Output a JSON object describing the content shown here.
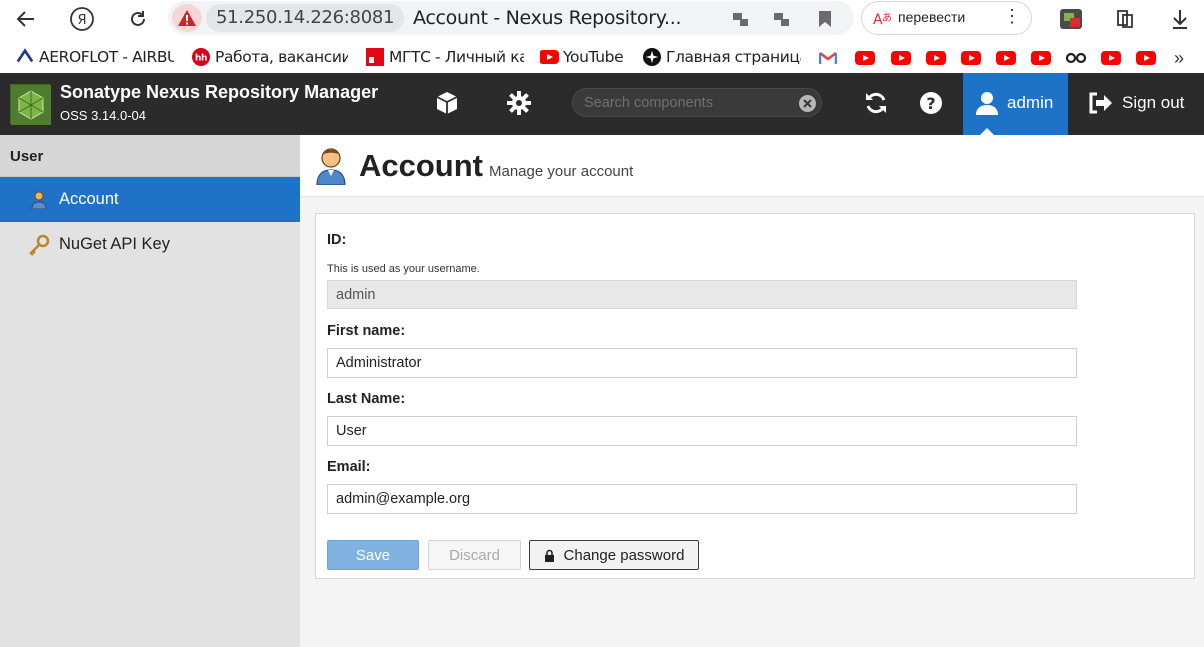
{
  "browser": {
    "url_host": "51.250.14.226:8081",
    "tab_title": "Account - Nexus Repository...",
    "translate_label": "перевести",
    "bookmarks": [
      {
        "label": "AEROFLOT - AIRBU",
        "icon": "aeroflot-icon"
      },
      {
        "label": "Работа, вакансии,",
        "icon": "hh-icon"
      },
      {
        "label": "МГТС - Личный ка",
        "icon": "mgts-icon"
      },
      {
        "label": "YouTube",
        "icon": "youtube-icon"
      },
      {
        "label": "Главная страница",
        "icon": "star-compass-icon"
      }
    ]
  },
  "header": {
    "title": "Sonatype Nexus Repository Manager",
    "version": "OSS 3.14.0-04",
    "search_placeholder": "Search components",
    "user_label": "admin",
    "signout_label": "Sign out"
  },
  "sidebar": {
    "section_label": "User",
    "items": [
      {
        "label": "Account",
        "icon": "user-icon",
        "active": true
      },
      {
        "label": "NuGet API Key",
        "icon": "key-icon",
        "active": false
      }
    ]
  },
  "main": {
    "title": "Account",
    "subtitle": "Manage your account",
    "form": {
      "id_label": "ID:",
      "id_help": "This is used as your username.",
      "id_value": "admin",
      "first_name_label": "First name:",
      "first_name_value": "Administrator",
      "last_name_label": "Last Name:",
      "last_name_value": "User",
      "email_label": "Email:",
      "email_value": "admin@example.org"
    },
    "buttons": {
      "save": "Save",
      "discard": "Discard",
      "change_password": "Change password"
    }
  },
  "colors": {
    "header_bg": "#2b2b2b",
    "accent_blue": "#1e73c8",
    "save_button": "#80b3e1",
    "sidebar_bg": "#e2e2e2"
  }
}
